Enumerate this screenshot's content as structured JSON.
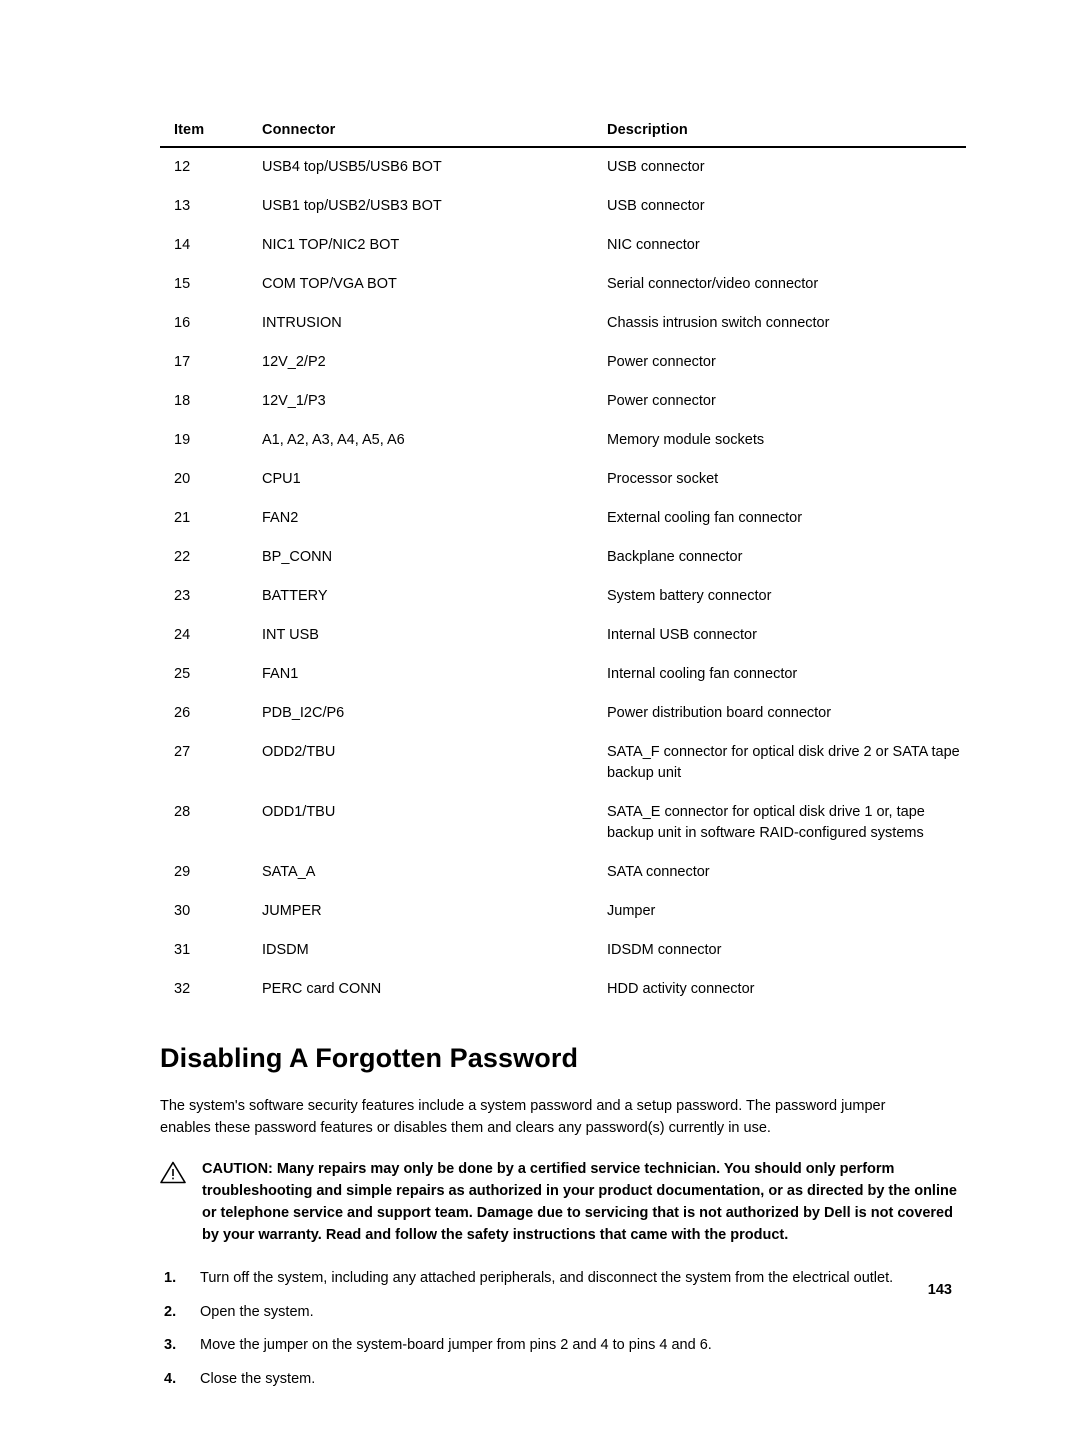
{
  "table": {
    "headers": [
      "Item",
      "Connector",
      "Description"
    ],
    "rows": [
      [
        "12",
        "USB4 top/USB5/USB6 BOT",
        "USB connector"
      ],
      [
        "13",
        "USB1 top/USB2/USB3 BOT",
        "USB connector"
      ],
      [
        "14",
        "NIC1 TOP/NIC2 BOT",
        "NIC connector"
      ],
      [
        "15",
        "COM TOP/VGA BOT",
        "Serial connector/video connector"
      ],
      [
        "16",
        "INTRUSION",
        "Chassis intrusion switch connector"
      ],
      [
        "17",
        "12V_2/P2",
        "Power connector"
      ],
      [
        "18",
        "12V_1/P3",
        "Power connector"
      ],
      [
        "19",
        "A1, A2, A3, A4, A5, A6",
        "Memory module sockets"
      ],
      [
        "20",
        "CPU1",
        "Processor socket"
      ],
      [
        "21",
        "FAN2",
        "External cooling fan connector"
      ],
      [
        "22",
        "BP_CONN",
        "Backplane connector"
      ],
      [
        "23",
        "BATTERY",
        "System battery connector"
      ],
      [
        "24",
        "INT USB",
        "Internal USB connector"
      ],
      [
        "25",
        "FAN1",
        "Internal cooling fan connector"
      ],
      [
        "26",
        "PDB_I2C/P6",
        "Power distribution board connector"
      ],
      [
        "27",
        "ODD2/TBU",
        "SATA_F connector for optical disk drive 2 or SATA tape backup unit"
      ],
      [
        "28",
        "ODD1/TBU",
        "SATA_E connector for optical disk drive 1 or, tape backup unit in software RAID-configured systems"
      ],
      [
        "29",
        "SATA_A",
        "SATA connector"
      ],
      [
        "30",
        "JUMPER",
        "Jumper"
      ],
      [
        "31",
        "IDSDM",
        "IDSDM connector"
      ],
      [
        "32",
        "PERC card CONN",
        "HDD activity connector"
      ]
    ]
  },
  "section": {
    "title": "Disabling A Forgotten Password",
    "intro": "The system's software security features include a system password and a setup password. The password jumper enables these password features or disables them and clears any password(s) currently in use.",
    "caution": "CAUTION: Many repairs may only be done by a certified service technician. You should only perform troubleshooting and simple repairs as authorized in your product documentation, or as directed by the online or telephone service and support team. Damage due to servicing that is not authorized by Dell is not covered by your warranty. Read and follow the safety instructions that came with the product.",
    "steps": [
      {
        "num": "1.",
        "text": "Turn off the system, including any attached peripherals, and disconnect the system from the electrical outlet."
      },
      {
        "num": "2.",
        "text": "Open the system."
      },
      {
        "num": "3.",
        "text": "Move the jumper on the system-board jumper from pins 2 and 4 to pins 4 and 6."
      },
      {
        "num": "4.",
        "text": "Close the system."
      }
    ]
  },
  "footer": {
    "page_number": "143"
  }
}
